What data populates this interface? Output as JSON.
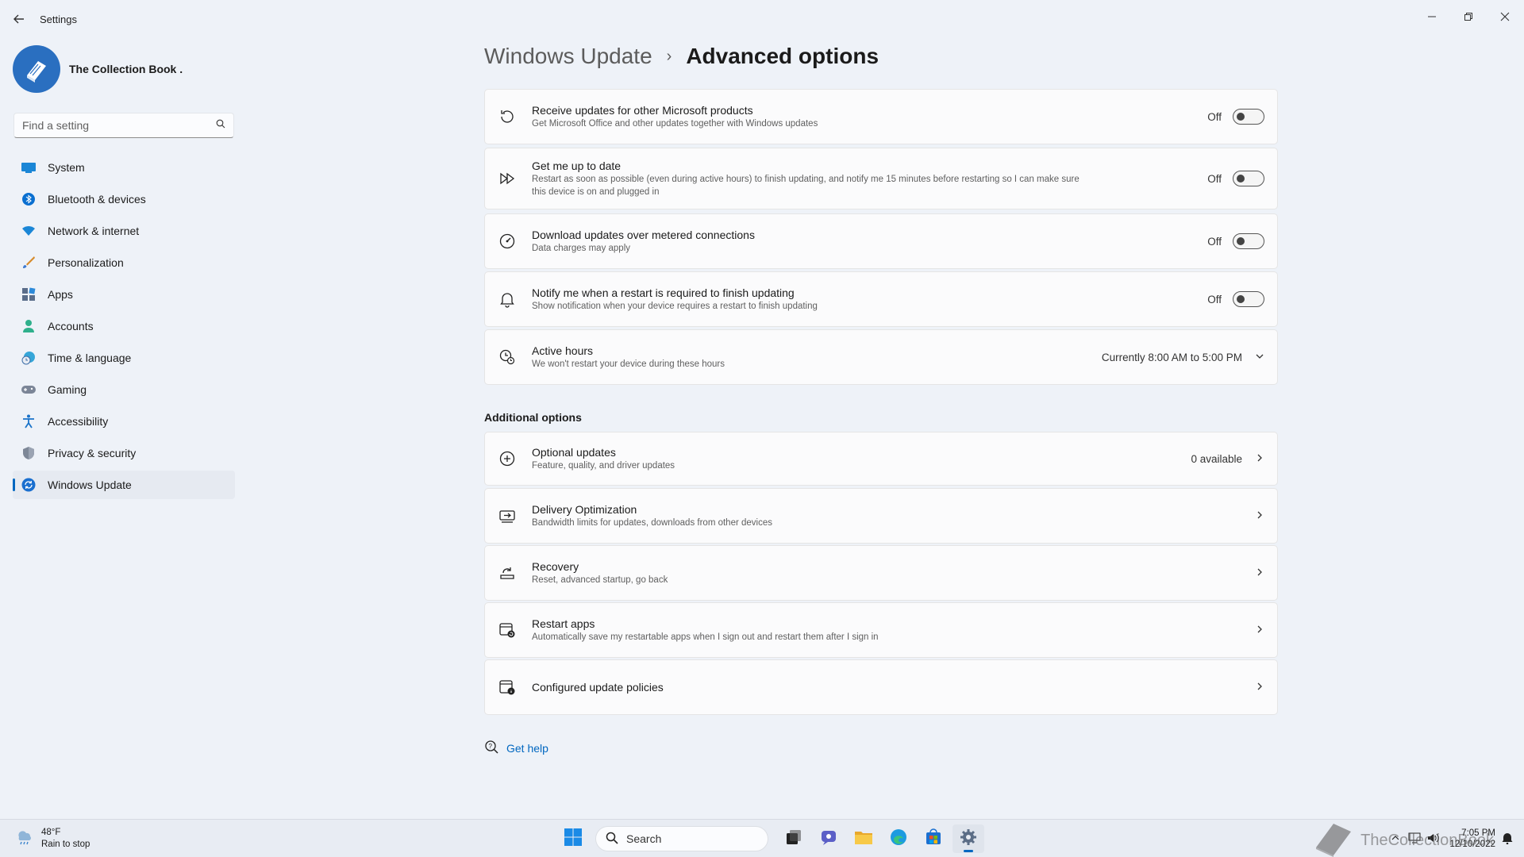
{
  "window": {
    "app_title": "Settings",
    "controls": [
      "minimize-icon",
      "restore-icon",
      "close-icon"
    ]
  },
  "profile": {
    "name": "The Collection Book ."
  },
  "search": {
    "placeholder": "Find a setting"
  },
  "nav": {
    "items": [
      {
        "label": "System",
        "icon": "system-icon"
      },
      {
        "label": "Bluetooth & devices",
        "icon": "bluetooth-icon"
      },
      {
        "label": "Network & internet",
        "icon": "wifi-icon"
      },
      {
        "label": "Personalization",
        "icon": "brush-icon"
      },
      {
        "label": "Apps",
        "icon": "apps-icon"
      },
      {
        "label": "Accounts",
        "icon": "person-icon"
      },
      {
        "label": "Time & language",
        "icon": "globe-clock-icon"
      },
      {
        "label": "Gaming",
        "icon": "gamepad-icon"
      },
      {
        "label": "Accessibility",
        "icon": "accessibility-icon"
      },
      {
        "label": "Privacy & security",
        "icon": "shield-icon"
      },
      {
        "label": "Windows Update",
        "icon": "update-icon"
      }
    ],
    "active_index": 10
  },
  "breadcrumb": {
    "parent": "Windows Update",
    "separator": "›",
    "current": "Advanced options"
  },
  "settings": [
    {
      "title": "Receive updates for other Microsoft products",
      "subtitle": "Get Microsoft Office and other updates together with Windows updates",
      "state": "Off",
      "icon": "refresh-icon"
    },
    {
      "title": "Get me up to date",
      "subtitle": "Restart as soon as possible (even during active hours) to finish updating, and notify me 15 minutes before restarting so I can make sure",
      "subtitle2": "this device is on and plugged in",
      "state": "Off",
      "icon": "fast-forward-icon"
    },
    {
      "title": "Download updates over metered connections",
      "subtitle": "Data charges may apply",
      "state": "Off",
      "icon": "gauge-icon"
    },
    {
      "title": "Notify me when a restart is required to finish updating",
      "subtitle": "Show notification when your device requires a restart to finish updating",
      "state": "Off",
      "icon": "bell-icon"
    }
  ],
  "active_hours": {
    "title": "Active hours",
    "subtitle": "We won't restart your device during these hours",
    "value": "Currently 8:00 AM to 5:00 PM",
    "icon": "clock-icon"
  },
  "additional": {
    "label": "Additional options",
    "items": [
      {
        "title": "Optional updates",
        "subtitle": "Feature, quality, and driver updates",
        "value": "0 available",
        "icon": "plus-circle-icon"
      },
      {
        "title": "Delivery Optimization",
        "subtitle": "Bandwidth limits for updates, downloads from other devices",
        "icon": "delivery-icon"
      },
      {
        "title": "Recovery",
        "subtitle": "Reset, advanced startup, go back",
        "icon": "recovery-icon"
      },
      {
        "title": "Restart apps",
        "subtitle": "Automatically save my restartable apps when I sign out and restart them after I sign in",
        "icon": "restart-apps-icon"
      },
      {
        "title": "Configured update policies",
        "icon": "policy-icon"
      }
    ]
  },
  "help": {
    "label": "Get help"
  },
  "taskbar": {
    "weather_temp": "48°F",
    "weather_desc": "Rain to stop",
    "search_label": "Search",
    "time": "7:05 PM",
    "date": "12/10/2022"
  },
  "watermark": {
    "text": "TheCollectionBook"
  },
  "colors": {
    "accent": "#0067c0",
    "background": "#eef2f8",
    "card": "#fbfbfc"
  }
}
